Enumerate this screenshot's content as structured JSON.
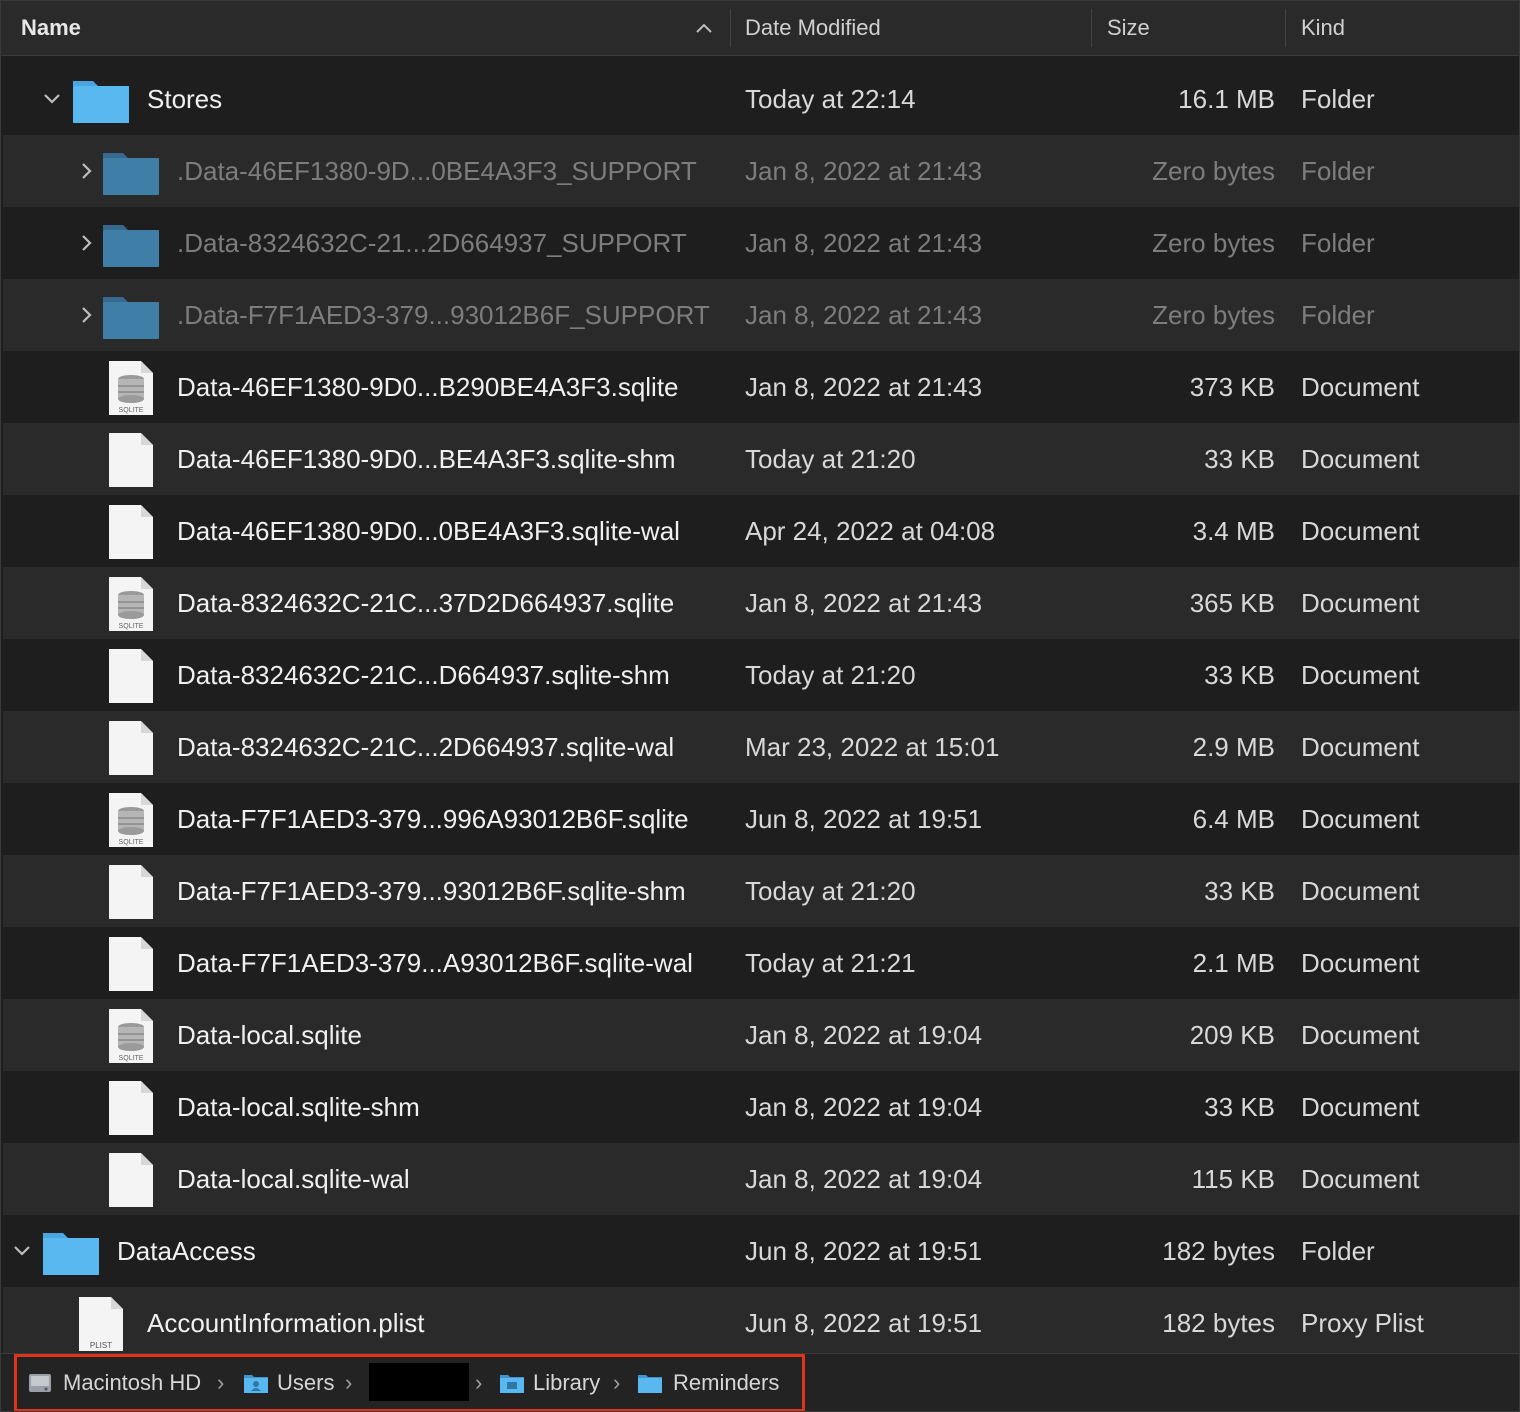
{
  "header": {
    "name": "Name",
    "date": "Date Modified",
    "size": "Size",
    "kind": "Kind"
  },
  "rows": [
    {
      "name": "Stores",
      "date": "Today at 22:14",
      "size": "16.1 MB",
      "kind": "Folder"
    },
    {
      "name": ".Data-46EF1380-9D...0BE4A3F3_SUPPORT",
      "date": "Jan 8, 2022 at 21:43",
      "size": "Zero bytes",
      "kind": "Folder"
    },
    {
      "name": ".Data-8324632C-21...2D664937_SUPPORT",
      "date": "Jan 8, 2022 at 21:43",
      "size": "Zero bytes",
      "kind": "Folder"
    },
    {
      "name": ".Data-F7F1AED3-379...93012B6F_SUPPORT",
      "date": "Jan 8, 2022 at 21:43",
      "size": "Zero bytes",
      "kind": "Folder"
    },
    {
      "name": "Data-46EF1380-9D0...B290BE4A3F3.sqlite",
      "date": "Jan 8, 2022 at 21:43",
      "size": "373 KB",
      "kind": "Document"
    },
    {
      "name": "Data-46EF1380-9D0...BE4A3F3.sqlite-shm",
      "date": "Today at 21:20",
      "size": "33 KB",
      "kind": "Document"
    },
    {
      "name": "Data-46EF1380-9D0...0BE4A3F3.sqlite-wal",
      "date": "Apr 24, 2022 at 04:08",
      "size": "3.4 MB",
      "kind": "Document"
    },
    {
      "name": "Data-8324632C-21C...37D2D664937.sqlite",
      "date": "Jan 8, 2022 at 21:43",
      "size": "365 KB",
      "kind": "Document"
    },
    {
      "name": "Data-8324632C-21C...D664937.sqlite-shm",
      "date": "Today at 21:20",
      "size": "33 KB",
      "kind": "Document"
    },
    {
      "name": "Data-8324632C-21C...2D664937.sqlite-wal",
      "date": "Mar 23, 2022 at 15:01",
      "size": "2.9 MB",
      "kind": "Document"
    },
    {
      "name": "Data-F7F1AED3-379...996A93012B6F.sqlite",
      "date": "Jun 8, 2022 at 19:51",
      "size": "6.4 MB",
      "kind": "Document"
    },
    {
      "name": "Data-F7F1AED3-379...93012B6F.sqlite-shm",
      "date": "Today at 21:20",
      "size": "33 KB",
      "kind": "Document"
    },
    {
      "name": "Data-F7F1AED3-379...A93012B6F.sqlite-wal",
      "date": "Today at 21:21",
      "size": "2.1 MB",
      "kind": "Document"
    },
    {
      "name": "Data-local.sqlite",
      "date": "Jan 8, 2022 at 19:04",
      "size": "209 KB",
      "kind": "Document"
    },
    {
      "name": "Data-local.sqlite-shm",
      "date": "Jan 8, 2022 at 19:04",
      "size": "33 KB",
      "kind": "Document"
    },
    {
      "name": "Data-local.sqlite-wal",
      "date": "Jan 8, 2022 at 19:04",
      "size": "115 KB",
      "kind": "Document"
    },
    {
      "name": "DataAccess",
      "date": "Jun 8, 2022 at 19:51",
      "size": "182 bytes",
      "kind": "Folder"
    },
    {
      "name": "AccountInformation.plist",
      "date": "Jun 8, 2022 at 19:51",
      "size": "182 bytes",
      "kind": "Proxy Plist"
    }
  ],
  "icons": {
    "sqlite_badge": "SQLITE",
    "plist_badge": "PLIST"
  },
  "pathbar": {
    "items": [
      "Macintosh HD",
      "Users",
      "Library",
      "Reminders"
    ]
  },
  "colors": {
    "folder": "#5ab8f0",
    "folder_dim": "#3f7ea6",
    "highlight_border": "#e0331c"
  }
}
